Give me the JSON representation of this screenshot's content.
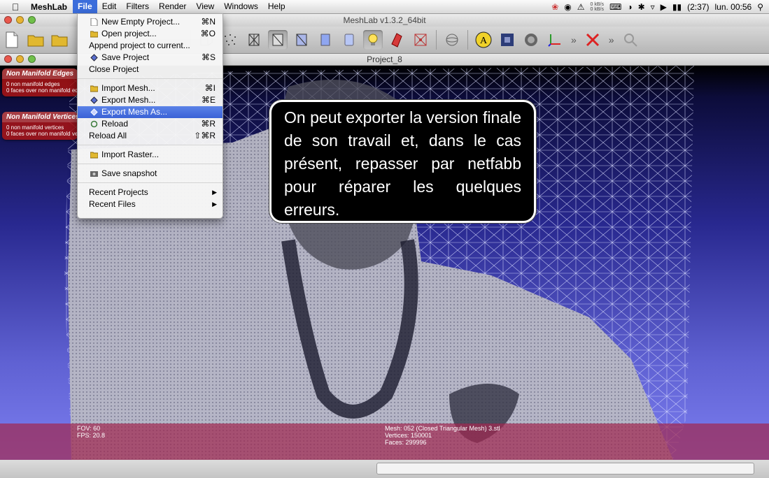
{
  "menubar": {
    "app_name": "MeshLab",
    "items": [
      "File",
      "Edit",
      "Filters",
      "Render",
      "View",
      "Windows",
      "Help"
    ],
    "status": {
      "net_up": "0 kB/s",
      "net_down": "0 kB/s",
      "battery": "(2:37)",
      "clock": "lun. 00:56"
    }
  },
  "window": {
    "title": "MeshLab v1.3.2_64bit"
  },
  "document": {
    "title": "Project_8"
  },
  "file_menu": {
    "items": [
      {
        "label": "New Empty Project...",
        "shortcut": "⌘N"
      },
      {
        "label": "Open project...",
        "shortcut": "⌘O"
      },
      {
        "label": "Append project to current...",
        "shortcut": ""
      },
      {
        "label": "Save Project",
        "shortcut": "⌘S"
      },
      {
        "label": "Close Project",
        "shortcut": ""
      },
      {
        "label": "Import Mesh...",
        "shortcut": "⌘I"
      },
      {
        "label": "Export Mesh...",
        "shortcut": "⌘E"
      },
      {
        "label": "Export Mesh As...",
        "shortcut": ""
      },
      {
        "label": "Reload",
        "shortcut": "⌘R"
      },
      {
        "label": "Reload All",
        "shortcut": "⇧⌘R"
      },
      {
        "label": "Import Raster...",
        "shortcut": ""
      },
      {
        "label": "Save snapshot",
        "shortcut": ""
      },
      {
        "label": "Recent Projects",
        "shortcut": ""
      },
      {
        "label": "Recent Files",
        "shortcut": ""
      }
    ],
    "highlighted": "Export Mesh As..."
  },
  "decorators": [
    {
      "title": "Non Manifold Edges",
      "line1": "0 non manifold edges",
      "line2": "0 faces over non manifold edges"
    },
    {
      "title": "Non Manifold Vertices",
      "line1": "0 non manifold vertices",
      "line2": "0 faces over non manifold vertices"
    }
  ],
  "viewport_info": {
    "fov": "FOV: 60",
    "fps": "FPS:    20.8",
    "mesh": "Mesh: 052 (Closed Triangular Mesh) 3.stl",
    "vertices": "Vertices: 150001",
    "faces": "Faces: 299996"
  },
  "callout": {
    "text": "On peut exporter la version finale de son travail et, dans le cas présent, repasser par netfabb pour réparer les quelques erreurs."
  },
  "colors": {
    "menu_highlight": "#3a62d6",
    "info_bar": "#a02850",
    "decorator_panel": "#aa1414"
  }
}
